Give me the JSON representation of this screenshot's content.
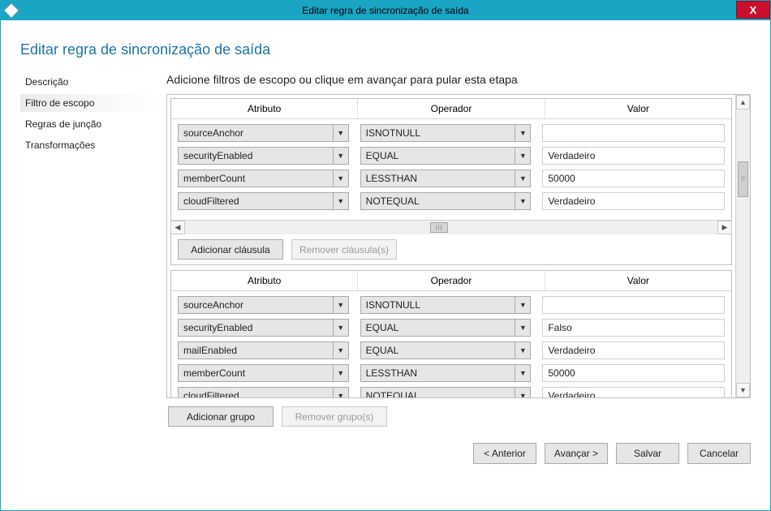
{
  "window": {
    "title": "Editar regra de sincronização de saída",
    "close_label": "X"
  },
  "page": {
    "heading": "Editar regra de sincronização de saída",
    "instruction": "Adicione filtros de escopo ou clique em avançar para pular esta etapa"
  },
  "sidebar": {
    "items": [
      {
        "label": "Descrição",
        "active": false
      },
      {
        "label": "Filtro de escopo",
        "active": true
      },
      {
        "label": "Regras de junção",
        "active": false
      },
      {
        "label": "Transformações",
        "active": false
      }
    ]
  },
  "table_headers": {
    "attribute": "Atributo",
    "operator": "Operador",
    "value": "Valor"
  },
  "groups": [
    {
      "rows": [
        {
          "attribute": "sourceAnchor",
          "operator": "ISNOTNULL",
          "value": ""
        },
        {
          "attribute": "securityEnabled",
          "operator": "EQUAL",
          "value": "Verdadeiro"
        },
        {
          "attribute": "memberCount",
          "operator": "LESSTHAN",
          "value": "50000"
        },
        {
          "attribute": "cloudFiltered",
          "operator": "NOTEQUAL",
          "value": "Verdadeiro"
        }
      ]
    },
    {
      "rows": [
        {
          "attribute": "sourceAnchor",
          "operator": "ISNOTNULL",
          "value": ""
        },
        {
          "attribute": "securityEnabled",
          "operator": "EQUAL",
          "value": "Falso"
        },
        {
          "attribute": "mailEnabled",
          "operator": "EQUAL",
          "value": "Verdadeiro"
        },
        {
          "attribute": "memberCount",
          "operator": "LESSTHAN",
          "value": "50000"
        },
        {
          "attribute": "cloudFiltered",
          "operator": "NOTEQUAL",
          "value": "Verdadeiro"
        }
      ]
    }
  ],
  "buttons": {
    "add_clause": "Adicionar cláusula",
    "remove_clause": "Remover cláusula(s)",
    "add_group": "Adicionar grupo",
    "remove_group": "Remover grupo(s)",
    "prev": "< Anterior",
    "next": "Avançar >",
    "save": "Salvar",
    "cancel": "Cancelar"
  }
}
